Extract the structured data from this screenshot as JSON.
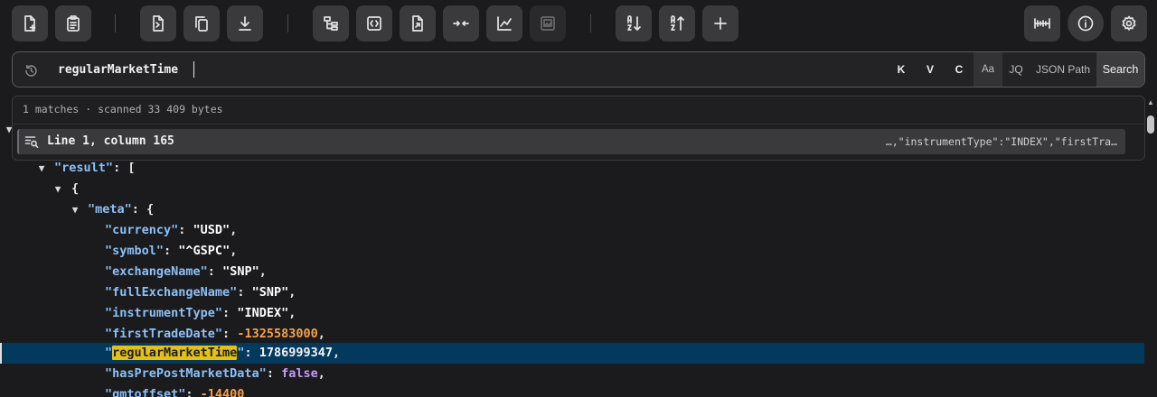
{
  "toolbar": {
    "buttons": [
      {
        "name": "new-document-icon"
      },
      {
        "name": "clipboard-icon"
      },
      {
        "name": "format-document-icon"
      },
      {
        "name": "copy-icon"
      },
      {
        "name": "download-icon"
      },
      {
        "name": "tree-view-icon"
      },
      {
        "name": "code-view-icon"
      },
      {
        "name": "file-export-icon"
      },
      {
        "name": "collapse-icon"
      },
      {
        "name": "chart-icon"
      },
      {
        "name": "image-icon"
      },
      {
        "name": "sort-ascending-icon"
      },
      {
        "name": "sort-descending-icon"
      },
      {
        "name": "plus-icon"
      },
      {
        "name": "ruler-icon"
      },
      {
        "name": "info-icon"
      },
      {
        "name": "settings-icon"
      }
    ]
  },
  "search": {
    "value": "regularMarketTime",
    "options": {
      "keys": "K",
      "values": "V",
      "case": "C",
      "match_case": "Aa",
      "jq": "JQ",
      "json_path": "JSON Path",
      "submit": "Search"
    }
  },
  "results": {
    "summary": "1 matches · scanned 33 409 bytes",
    "items": [
      {
        "label": "Line 1, column 165",
        "snippet": "…,\"instrumentType\":\"INDEX\",\"firstTra…"
      }
    ]
  },
  "tree": {
    "lines": [
      {
        "prefix": "\"",
        "key": "result",
        "suffix": "\": ["
      },
      {
        "text": "{"
      },
      {
        "prefix": "\"",
        "key": "meta",
        "suffix": "\": {"
      },
      {
        "key": "\"currency\"",
        "sep": ": ",
        "value": "\"USD\"",
        "end": ","
      },
      {
        "key": "\"symbol\"",
        "sep": ": ",
        "value": "\"^GSPC\"",
        "end": ","
      },
      {
        "key": "\"exchangeName\"",
        "sep": ": ",
        "value": "\"SNP\"",
        "end": ","
      },
      {
        "key": "\"fullExchangeName\"",
        "sep": ": ",
        "value": "\"SNP\"",
        "end": ","
      },
      {
        "key": "\"instrumentType\"",
        "sep": ": ",
        "value": "\"INDEX\"",
        "end": ","
      },
      {
        "key": "\"firstTradeDate\"",
        "sep": ": ",
        "value": "-1325583000",
        "end": ","
      },
      {
        "quote_open": "\"",
        "key": "regularMarketTime",
        "quote_close": "\"",
        "sep": ": ",
        "value": "1786999347",
        "end": ","
      },
      {
        "key": "\"hasPrePostMarketData\"",
        "sep": ": ",
        "value": "false",
        "end": ","
      },
      {
        "key": "\"gmtoffset\"",
        "sep": ": ",
        "value": "-14400",
        "end": ""
      }
    ]
  }
}
